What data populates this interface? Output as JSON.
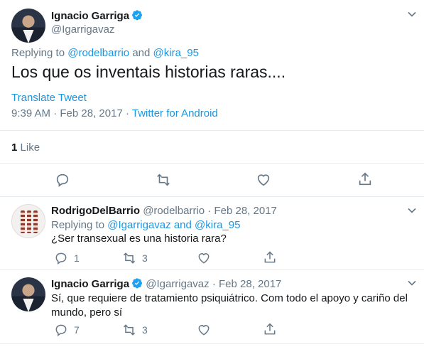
{
  "main_tweet": {
    "display_name": "Ignacio Garriga",
    "handle": "@Igarrigavaz",
    "replying_prefix": "Replying to",
    "reply_handle_1": "@rodelbarrio",
    "reply_and": "and",
    "reply_handle_2": "@kira_95",
    "text": "Los que os inventais historias raras....",
    "translate": "Translate Tweet",
    "time": "9:39 AM",
    "date": "Feb 28, 2017",
    "separator": "·",
    "source": "Twitter for Android",
    "like_count": "1",
    "like_label": "Like"
  },
  "reply_1": {
    "display_name": "RodrigoDelBarrio",
    "handle": "@rodelbarrio",
    "separator": "·",
    "date": "Feb 28, 2017",
    "replying_prefix": "Replying to",
    "reply_handle_1": "@Igarrigavaz",
    "reply_and": "and",
    "reply_handle_2": "@kira_95",
    "text": "¿Ser transexual es una historia rara?",
    "reply_count": "1",
    "retweet_count": "3"
  },
  "reply_2": {
    "display_name": "Ignacio Garriga",
    "handle": "@Igarrigavaz",
    "separator": "·",
    "date": "Feb 28, 2017",
    "text_line_1": "Sí, que requiere de tratamiento psiquiátrico. Com todo el apoyo y cariño del",
    "text_line_2": "mundo, pero sí",
    "reply_count": "7",
    "retweet_count": "3"
  },
  "icons": {
    "verified": "verified-badge-icon",
    "chevron": "chevron-down-icon",
    "reply": "reply-icon",
    "retweet": "retweet-icon",
    "like": "heart-icon",
    "share": "share-icon"
  },
  "colors": {
    "link": "#1b95e0",
    "muted": "#657786",
    "text": "#14171a",
    "divider": "#e6ecf0"
  }
}
